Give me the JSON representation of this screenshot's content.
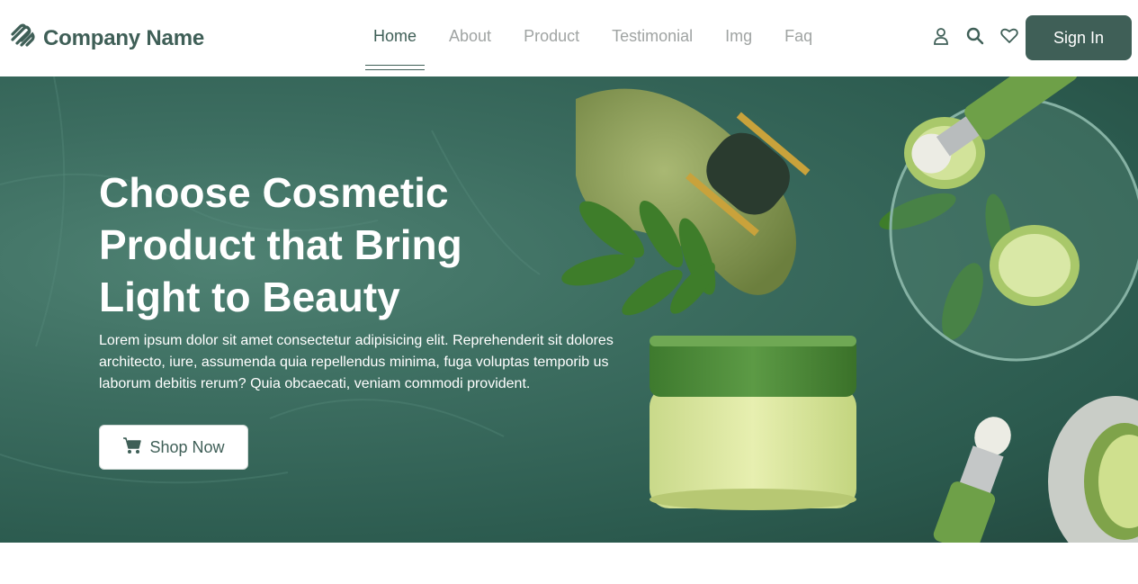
{
  "brand": {
    "name": "Company Name",
    "logo_icon": "stripes-logo-icon"
  },
  "nav": {
    "items": [
      {
        "label": "Home",
        "active": true
      },
      {
        "label": "About",
        "active": false
      },
      {
        "label": "Product",
        "active": false
      },
      {
        "label": "Testimonial",
        "active": false
      },
      {
        "label": "Img",
        "active": false
      },
      {
        "label": "Faq",
        "active": false
      }
    ]
  },
  "header_icons": [
    "user-icon",
    "search-icon",
    "heart-icon"
  ],
  "signin": {
    "label": "Sign In"
  },
  "hero": {
    "title": "Choose Cosmetic Product that Bring Light to Beauty",
    "description": "Lorem ipsum dolor sit amet consectetur adipisicing elit. Reprehenderit sit dolores architecto, iure, assumenda quia repellendus minima, fuga voluptas temporib us laborum debitis rerum? Quia obcaecati, veniam commodi provident.",
    "cta_label": "Shop Now",
    "cta_icon": "cart-icon"
  },
  "colors": {
    "brand": "#3f5f57",
    "nav_inactive": "#a0a4a3",
    "hero_bg": "#3c6d60",
    "white": "#ffffff"
  }
}
